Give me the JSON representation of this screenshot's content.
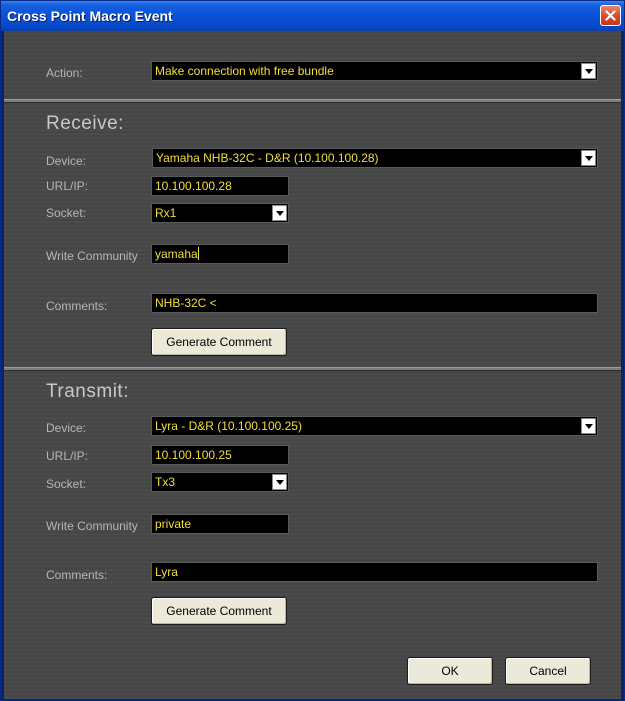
{
  "window": {
    "title": "Cross Point Macro Event"
  },
  "action": {
    "label": "Action:",
    "value": "Make connection with free bundle"
  },
  "receive": {
    "title": "Receive:",
    "device_label": "Device:",
    "device_value": "Yamaha NHB-32C - D&R (10.100.100.28)",
    "url_label": "URL/IP:",
    "url_value": "10.100.100.28",
    "socket_label": "Socket:",
    "socket_value": "Rx1",
    "community_label": "Write Community",
    "community_value": "yamaha",
    "comments_label": "Comments:",
    "comments_value": "NHB-32C <",
    "generate_label": "Generate Comment"
  },
  "transmit": {
    "title": "Transmit:",
    "device_label": "Device:",
    "device_value": "Lyra - D&R (10.100.100.25)",
    "url_label": "URL/IP:",
    "url_value": "10.100.100.25",
    "socket_label": "Socket:",
    "socket_value": "Tx3",
    "community_label": "Write Community",
    "community_value": "private",
    "comments_label": "Comments:",
    "comments_value": "Lyra",
    "generate_label": "Generate Comment"
  },
  "footer": {
    "ok_label": "OK",
    "cancel_label": "Cancel"
  },
  "colors": {
    "title_bar": "#0a52d8",
    "field_text": "#f2df3a",
    "panel_bg": "#474747",
    "label_text": "#b6b6b6"
  },
  "icons": {
    "close": "close-icon",
    "dropdown": "chevron-down-icon"
  }
}
